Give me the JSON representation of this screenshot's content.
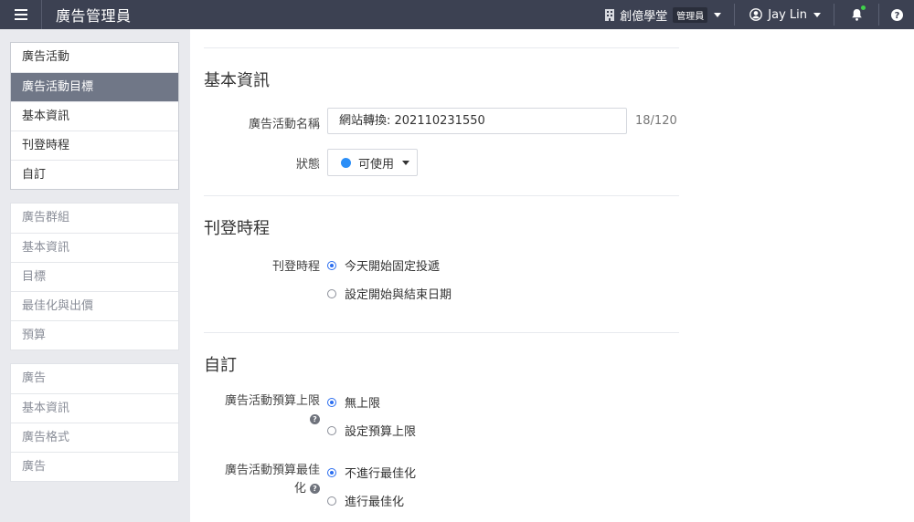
{
  "header": {
    "app_title": "廣告管理員",
    "account_name": "創億學堂",
    "account_role": "管理員",
    "user_name": "Jay Lin"
  },
  "sidebar": {
    "campaign": [
      "廣告活動",
      "廣告活動目標",
      "基本資訊",
      "刊登時程",
      "自訂"
    ],
    "adgroup": [
      "廣告群組",
      "基本資訊",
      "目標",
      "最佳化與出價",
      "預算"
    ],
    "ad": [
      "廣告",
      "基本資訊",
      "廣告格式",
      "廣告"
    ]
  },
  "basic_info": {
    "title": "基本資訊",
    "name_label": "廣告活動名稱",
    "name_value": "網站轉換: 202110231550",
    "name_counter": "18/120",
    "status_label": "狀態",
    "status_value": "可使用"
  },
  "schedule": {
    "title": "刊登時程",
    "label": "刊登時程",
    "options": [
      "今天開始固定投遞",
      "設定開始與結束日期"
    ]
  },
  "custom": {
    "title": "自訂",
    "budget_limit_label": "廣告活動預算上限",
    "budget_limit_options": [
      "無上限",
      "設定預算上限"
    ],
    "budget_opt_label_line1": "廣告活動預算最佳",
    "budget_opt_label_line2": "化",
    "budget_opt_options": [
      "不進行最佳化",
      "進行最佳化"
    ]
  },
  "colors": {
    "topbar": "#3c4152",
    "active_nav": "#707787",
    "status_dot": "#2b8ef7",
    "notification_dot": "#3fd14a"
  }
}
